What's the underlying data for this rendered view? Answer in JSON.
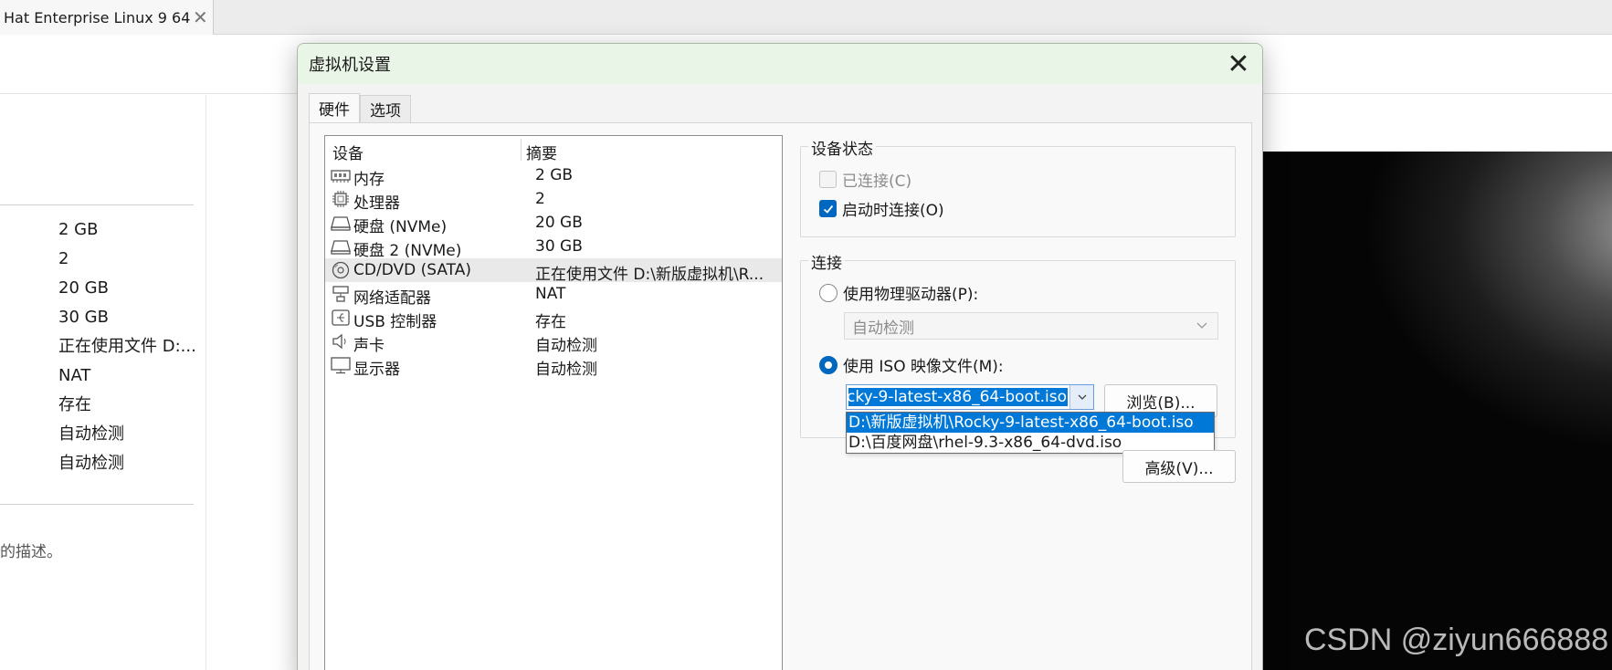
{
  "background_window": {
    "tab_title": "Hat Enterprise Linux 9 64 ...",
    "summary_values": [
      "2 GB",
      "2",
      "20 GB",
      "30 GB",
      "正在使用文件 D:...",
      "NAT",
      "存在",
      "自动检测",
      "自动检测"
    ],
    "description_fragment": "的描述。"
  },
  "dialog": {
    "title": "虚拟机设置",
    "tabs": [
      {
        "label": "硬件",
        "active": true
      },
      {
        "label": "选项",
        "active": false
      }
    ],
    "device_list": {
      "columns": [
        "设备",
        "摘要"
      ],
      "rows": [
        {
          "icon": "memory-icon",
          "name": "内存",
          "summary": "2 GB"
        },
        {
          "icon": "cpu-icon",
          "name": "处理器",
          "summary": "2"
        },
        {
          "icon": "disk-icon",
          "name": "硬盘 (NVMe)",
          "summary": "20 GB"
        },
        {
          "icon": "disk-icon",
          "name": "硬盘 2 (NVMe)",
          "summary": "30 GB"
        },
        {
          "icon": "cd-icon",
          "name": "CD/DVD (SATA)",
          "summary": "正在使用文件 D:\\新版虚拟机\\R...",
          "selected": true
        },
        {
          "icon": "network-icon",
          "name": "网络适配器",
          "summary": "NAT"
        },
        {
          "icon": "usb-icon",
          "name": "USB 控制器",
          "summary": "存在"
        },
        {
          "icon": "speaker-icon",
          "name": "声卡",
          "summary": "自动检测"
        },
        {
          "icon": "monitor-icon",
          "name": "显示器",
          "summary": "自动检测"
        }
      ]
    },
    "device_status": {
      "legend": "设备状态",
      "connected_label": "已连接(C)",
      "connected_checked": false,
      "connected_disabled": true,
      "connect_on_start_label": "启动时连接(O)",
      "connect_on_start_checked": true
    },
    "connection": {
      "legend": "连接",
      "physical_drive_label": "使用物理驱动器(P):",
      "physical_drive_selected": false,
      "physical_drive_value": "自动检测",
      "iso_label": "使用 ISO 映像文件(M):",
      "iso_selected": true,
      "iso_value": "D:\\新版虚拟机\\Rocky-9-latest-x86_64-boot.iso",
      "iso_options": [
        "D:\\新版虚拟机\\Rocky-9-latest-x86_64-boot.iso",
        "D:\\百度网盘\\rhel-9.3-x86_64-dvd.iso"
      ],
      "browse_label": "浏览(B)..."
    },
    "advanced_label": "高级(V)..."
  },
  "watermark": "CSDN @ziyun666888",
  "colors": {
    "accent": "#0067c0",
    "selection": "#0078d7",
    "title_bar": "#e9f5e6"
  }
}
